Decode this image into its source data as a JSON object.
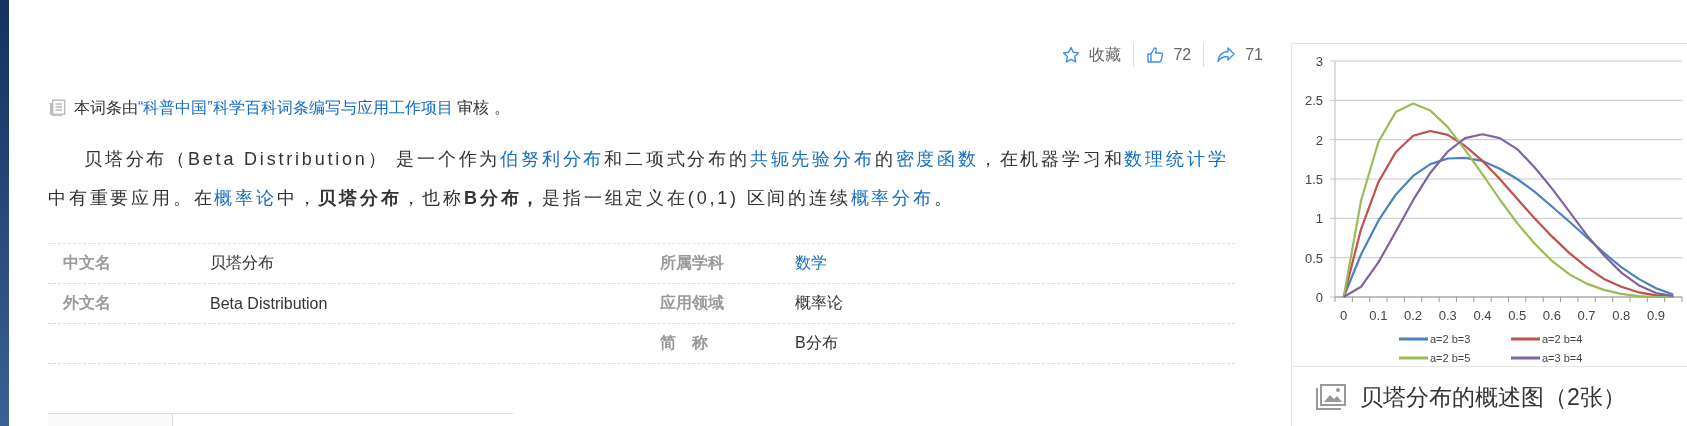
{
  "actions": [
    {
      "kind": "favorite",
      "label": "收藏"
    },
    {
      "kind": "like",
      "label": "72"
    },
    {
      "kind": "share",
      "label": "71"
    }
  ],
  "review_note": [
    {
      "kind": "text",
      "text": "本词条由"
    },
    {
      "kind": "link",
      "text": "“科普中国”科学百科词条编写与应用工作项目"
    },
    {
      "kind": "text",
      "text": " 审核 。"
    }
  ],
  "summary": [
    {
      "kind": "text",
      "text": "贝塔分布（Beta Distribution） 是一个作为"
    },
    {
      "kind": "link",
      "text": "伯努利分布"
    },
    {
      "kind": "text",
      "text": "和二项式分布的"
    },
    {
      "kind": "link",
      "text": "共轭先验分布"
    },
    {
      "kind": "text",
      "text": "的"
    },
    {
      "kind": "link",
      "text": "密度函数"
    },
    {
      "kind": "text",
      "text": "，在机器学习和"
    },
    {
      "kind": "link",
      "text": "数理统计学"
    },
    {
      "kind": "text",
      "text": "中有重要应用。在"
    },
    {
      "kind": "link",
      "text": "概率论"
    },
    {
      "kind": "text",
      "text": "中，**贝塔分布**，也称**B分布，**是指一组定义在(0,1) 区间的连续"
    },
    {
      "kind": "link",
      "text": "概率分布"
    },
    {
      "kind": "text",
      "text": "。"
    }
  ],
  "info_table": {
    "rows": [
      {
        "left": {
          "label": "中文名",
          "value": "贝塔分布",
          "kind": "text"
        },
        "right": {
          "label": "所属学科",
          "value": "数学",
          "kind": "link"
        }
      },
      {
        "left": {
          "label": "外文名",
          "value": "Beta Distribution",
          "kind": "text"
        },
        "right": {
          "label": "应用领域",
          "value": "概率论",
          "kind": "text"
        }
      },
      {
        "right": {
          "label": "简　称",
          "value": "B分布",
          "kind": "text"
        }
      }
    ]
  },
  "figure": {
    "caption": "贝塔分布的概述图（2张）",
    "chart_data": {
      "type": "line",
      "grid": true,
      "legend": true,
      "x": [
        0,
        0.05,
        0.1,
        0.15,
        0.2,
        0.25,
        0.3,
        0.35,
        0.4,
        0.45,
        0.5,
        0.55,
        0.6,
        0.65,
        0.7,
        0.75,
        0.8,
        0.85,
        0.9,
        0.95
      ],
      "xlim": [
        -0.025,
        0.975
      ],
      "ylim": [
        0,
        3
      ],
      "xticks": [
        0,
        0.1,
        0.2,
        0.3,
        0.4,
        0.5,
        0.6,
        0.7,
        0.8,
        0.9
      ],
      "yticks": [
        0,
        0.5,
        1,
        1.5,
        2,
        2.5,
        3
      ],
      "series": [
        {
          "name": "a=2 b=3",
          "color": "#4f81bd",
          "values": [
            0,
            0.54,
            0.97,
            1.3,
            1.54,
            1.69,
            1.76,
            1.77,
            1.73,
            1.63,
            1.5,
            1.34,
            1.15,
            0.96,
            0.76,
            0.56,
            0.38,
            0.23,
            0.11,
            0.03
          ]
        },
        {
          "name": "a=2 b=4",
          "color": "#c0504d",
          "values": [
            0,
            0.86,
            1.46,
            1.84,
            2.05,
            2.11,
            2.06,
            1.92,
            1.73,
            1.5,
            1.25,
            1,
            0.77,
            0.56,
            0.38,
            0.23,
            0.13,
            0.06,
            0.02,
            0
          ]
        },
        {
          "name": "a=2 b=5",
          "color": "#9bbb59",
          "values": [
            0,
            1.22,
            1.97,
            2.35,
            2.46,
            2.37,
            2.16,
            1.87,
            1.56,
            1.24,
            0.94,
            0.68,
            0.46,
            0.29,
            0.17,
            0.09,
            0.04,
            0.01,
            0,
            0
          ]
        },
        {
          "name": "a=3 b=4",
          "color": "#8064a2",
          "values": [
            0,
            0.13,
            0.44,
            0.83,
            1.23,
            1.58,
            1.85,
            2.02,
            2.07,
            2.02,
            1.88,
            1.65,
            1.38,
            1.09,
            0.79,
            0.53,
            0.31,
            0.15,
            0.05,
            0.01
          ]
        }
      ]
    }
  }
}
